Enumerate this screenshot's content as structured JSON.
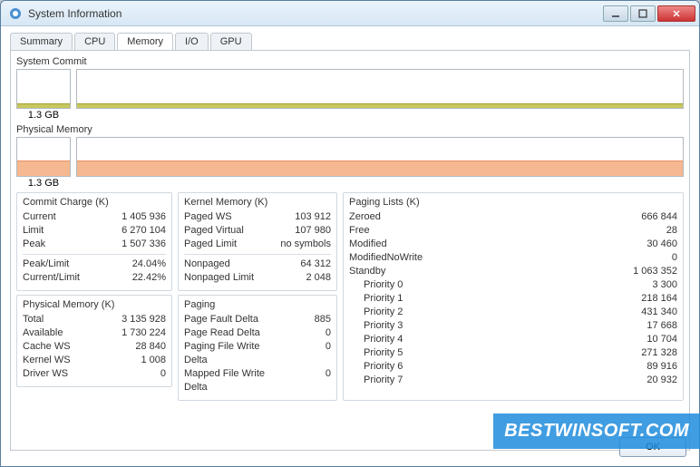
{
  "window": {
    "title": "System Information"
  },
  "tabs": [
    "Summary",
    "CPU",
    "Memory",
    "I/O",
    "GPU"
  ],
  "active_tab": "Memory",
  "graphs": {
    "commit": {
      "label": "System Commit",
      "small_label": "1.3 GB",
      "fill_pct": 12,
      "color": "#c8c860",
      "line": "#a0a030"
    },
    "physical": {
      "label": "Physical Memory",
      "small_label": "1.3 GB",
      "fill_pct": 40,
      "color": "#f5b890",
      "line": "#e89060"
    }
  },
  "commit_charge": {
    "title": "Commit Charge (K)",
    "current_l": "Current",
    "current_v": "1 405 936",
    "limit_l": "Limit",
    "limit_v": "6 270 104",
    "peak_l": "Peak",
    "peak_v": "1 507 336",
    "peak_limit_l": "Peak/Limit",
    "peak_limit_v": "24.04%",
    "cur_limit_l": "Current/Limit",
    "cur_limit_v": "22.42%"
  },
  "physical_memory": {
    "title": "Physical Memory (K)",
    "total_l": "Total",
    "total_v": "3 135 928",
    "avail_l": "Available",
    "avail_v": "1 730 224",
    "cache_l": "Cache WS",
    "cache_v": "28 840",
    "kernel_l": "Kernel WS",
    "kernel_v": "1 008",
    "driver_l": "Driver WS",
    "driver_v": "0"
  },
  "kernel_memory": {
    "title": "Kernel Memory (K)",
    "pws_l": "Paged WS",
    "pws_v": "103 912",
    "pv_l": "Paged Virtual",
    "pv_v": "107 980",
    "pl_l": "Paged Limit",
    "pl_v": "no symbols",
    "np_l": "Nonpaged",
    "np_v": "64 312",
    "npl_l": "Nonpaged Limit",
    "npl_v": "2 048"
  },
  "paging": {
    "title": "Paging",
    "pfd_l": "Page Fault Delta",
    "pfd_v": "885",
    "prd_l": "Page Read Delta",
    "prd_v": "0",
    "pfw_l": "Paging File Write Delta",
    "pfw_v": "0",
    "mfw_l": "Mapped File Write Delta",
    "mfw_v": "0"
  },
  "paging_lists": {
    "title": "Paging Lists (K)",
    "zeroed_l": "Zeroed",
    "zeroed_v": "666 844",
    "free_l": "Free",
    "free_v": "28",
    "mod_l": "Modified",
    "mod_v": "30 460",
    "mnw_l": "ModifiedNoWrite",
    "mnw_v": "0",
    "standby_l": "Standby",
    "standby_v": "1 063 352",
    "p0_l": "Priority 0",
    "p0_v": "3 300",
    "p1_l": "Priority 1",
    "p1_v": "218 164",
    "p2_l": "Priority 2",
    "p2_v": "431 340",
    "p3_l": "Priority 3",
    "p3_v": "17 668",
    "p4_l": "Priority 4",
    "p4_v": "10 704",
    "p5_l": "Priority 5",
    "p5_v": "271 328",
    "p6_l": "Priority 6",
    "p6_v": "89 916",
    "p7_l": "Priority 7",
    "p7_v": "20 932"
  },
  "ok_button": "OK",
  "watermark": "BESTWINSOFT.COM"
}
